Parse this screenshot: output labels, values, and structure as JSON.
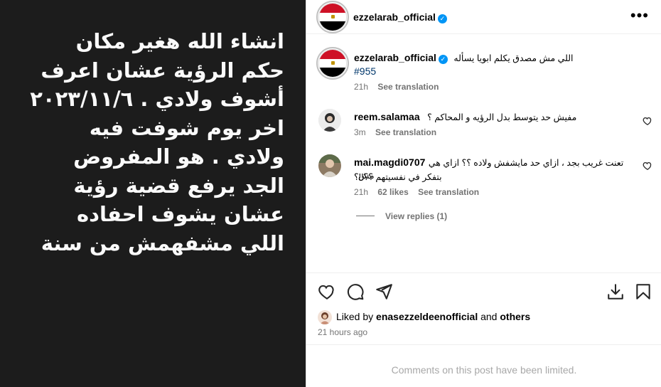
{
  "media": {
    "text": "انشاء الله هغير مكان حكم الرؤية عشان اعرف أشوف ولادي . ٢٠٢٣/١١/٦ اخر يوم شوفت فيه ولادي . هو المفروض الجد يرفع قضية رؤية عشان يشوف احفاده اللي مشفهمش من سنة"
  },
  "header": {
    "username": "ezzelarab_official",
    "verified_icon": "✓",
    "more_label": "•••"
  },
  "caption": {
    "username": "ezzelarab_official",
    "verified_icon": "✓",
    "text": "اللي مش مصدق يكلم ابويا يسأله",
    "hashtag": "#955",
    "time": "21h",
    "see_translation": "See translation"
  },
  "comments": [
    {
      "username": "reem.salamaa",
      "text": "مفيش حد يتوسط بدل الرؤيه و المحاكم ؟",
      "time": "3m",
      "see_translation": "See translation"
    },
    {
      "username": "mai.magdi0707",
      "text_line1": "تعنت غريب بجد ، ازاي حد مايشفش ولاده ؟؟ ازاي هي مش",
      "text_line2": "بتفكر في نفسيتهم ؟؟!!؟",
      "time": "21h",
      "likes": "62 likes",
      "see_translation": "See translation",
      "view_replies": "View replies (1)"
    }
  ],
  "likes": {
    "prefix": "Liked by",
    "user": "enasezzeldeenofficial",
    "and": "and",
    "others": "others"
  },
  "post_time": "21 hours ago",
  "comments_limited": "Comments on this post have been limited.",
  "colors": {
    "media_bg": "#1c1c1c",
    "verified": "#0095f6",
    "hashtag": "#00376b",
    "muted": "#737373",
    "flag_red": "#ce1126",
    "flag_black": "#000000"
  }
}
